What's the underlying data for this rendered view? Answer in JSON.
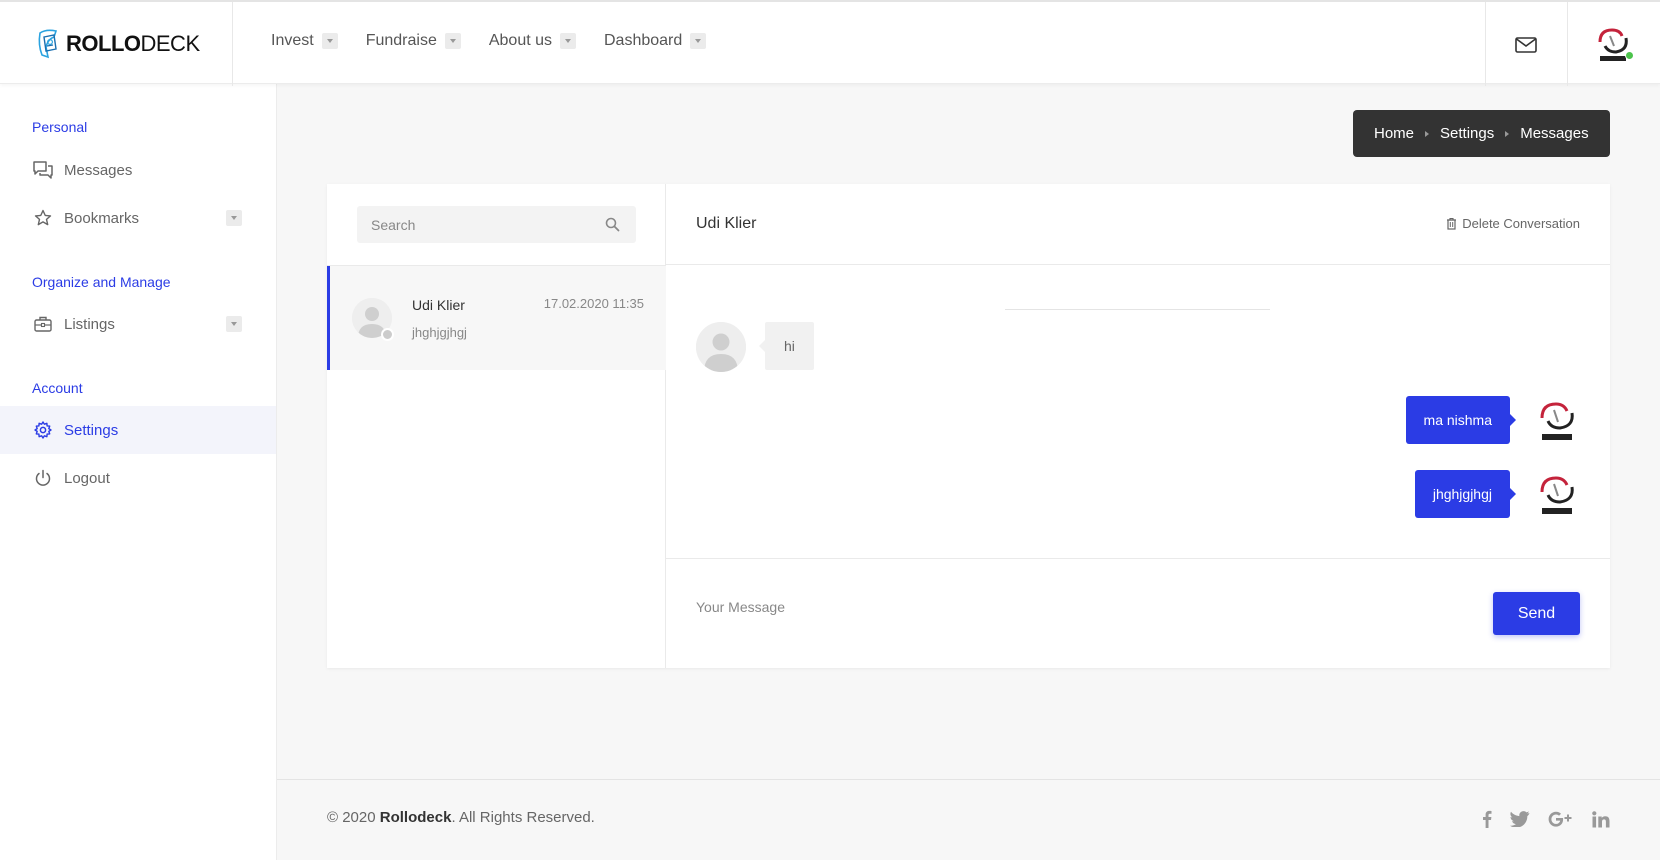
{
  "header": {
    "logo_bold": "ROLLO",
    "logo_light": "DECK",
    "nav": [
      {
        "label": "Invest"
      },
      {
        "label": "Fundraise"
      },
      {
        "label": "About us"
      },
      {
        "label": "Dashboard"
      }
    ],
    "icons": [
      "mail-icon",
      "user-avatar"
    ]
  },
  "sidebar": {
    "sections": [
      {
        "title": "Personal"
      },
      {
        "title": "Organize and Manage"
      },
      {
        "title": "Account"
      }
    ],
    "items": [
      {
        "label": "Messages",
        "icon": "chat-icon"
      },
      {
        "label": "Bookmarks",
        "icon": "star-icon"
      },
      {
        "label": "Listings",
        "icon": "briefcase-icon"
      },
      {
        "label": "Settings",
        "icon": "gear-icon",
        "active": true
      },
      {
        "label": "Logout",
        "icon": "power-icon"
      }
    ]
  },
  "breadcrumb": [
    "Home",
    "Settings",
    "Messages"
  ],
  "messages": {
    "search_placeholder": "Search",
    "conversations": [
      {
        "name": "Udi Klier",
        "time": "17.02.2020 11:35",
        "preview": "jhghjgjhgj"
      }
    ],
    "chat": {
      "title": "Udi Klier",
      "delete_label": "Delete Conversation",
      "incoming": [
        {
          "text": "hi"
        }
      ],
      "outgoing": [
        {
          "text": "ma nishma"
        },
        {
          "text": "jhghjgjhgj"
        }
      ]
    },
    "compose_placeholder": "Your Message",
    "send_label": "Send"
  },
  "footer": {
    "prefix": "© 2020 ",
    "brand": "Rollodeck",
    "suffix": ". All Rights Reserved.",
    "socials": [
      "facebook-icon",
      "twitter-icon",
      "google-plus-icon",
      "linkedin-icon"
    ]
  },
  "colors": {
    "accent": "#2b3ce5",
    "breadcrumb_bg": "#333333",
    "online": "#4cc34c"
  }
}
